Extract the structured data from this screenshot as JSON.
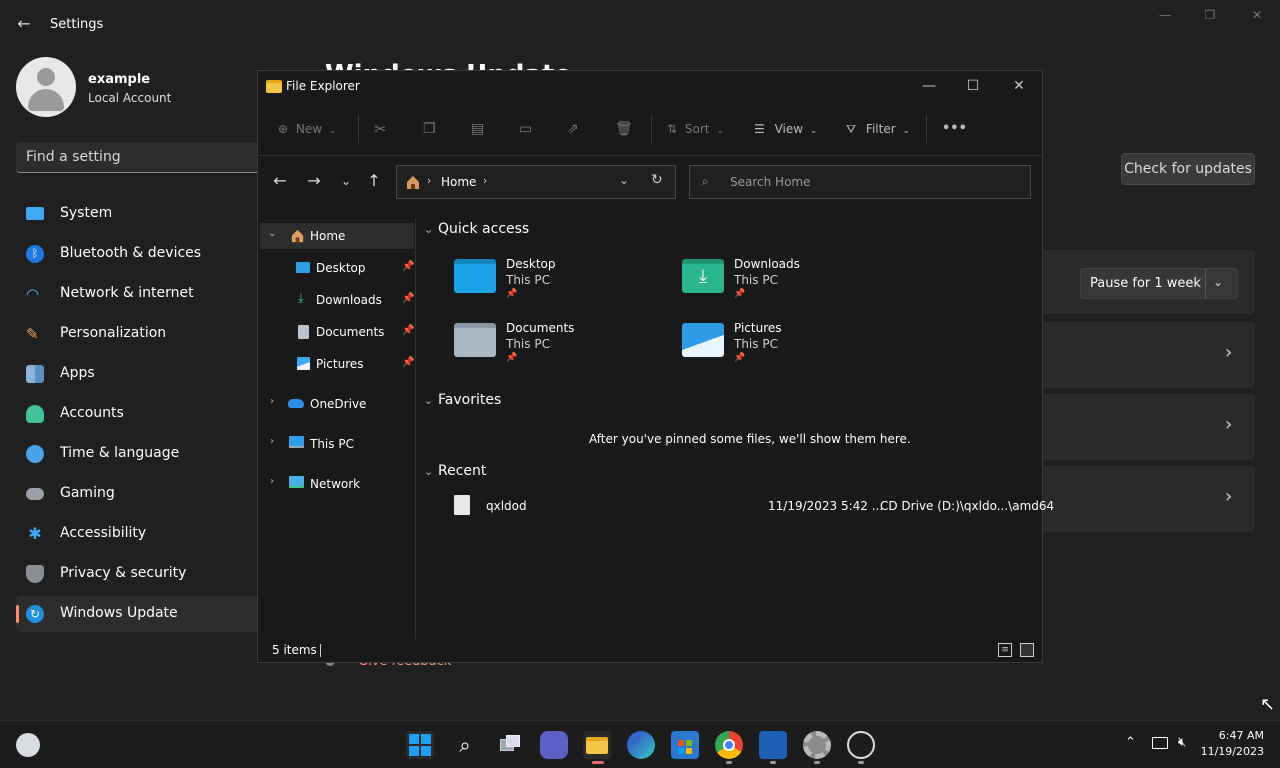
{
  "settings": {
    "title": "Settings",
    "user": {
      "name": "example",
      "type": "Local Account"
    },
    "search_placeholder": "Find a setting",
    "nav": [
      {
        "label": "System",
        "icon": "system-icon"
      },
      {
        "label": "Bluetooth & devices",
        "icon": "bluetooth-icon"
      },
      {
        "label": "Network & internet",
        "icon": "wifi-icon"
      },
      {
        "label": "Personalization",
        "icon": "brush-icon"
      },
      {
        "label": "Apps",
        "icon": "apps-icon"
      },
      {
        "label": "Accounts",
        "icon": "person-icon"
      },
      {
        "label": "Time & language",
        "icon": "clock-globe-icon"
      },
      {
        "label": "Gaming",
        "icon": "gamepad-icon"
      },
      {
        "label": "Accessibility",
        "icon": "accessibility-icon"
      },
      {
        "label": "Privacy & security",
        "icon": "shield-icon"
      },
      {
        "label": "Windows Update",
        "icon": "update-icon",
        "selected": true
      }
    ],
    "page_title": "Windows Update",
    "check_button": "Check for updates",
    "pause_button": "Pause for 1 week",
    "feedback": "Give feedback"
  },
  "explorer": {
    "title": "File Explorer",
    "toolbar": {
      "new": "New",
      "sort": "Sort",
      "view": "View",
      "filter": "Filter",
      "more": "•••"
    },
    "address": {
      "crumb": "Home"
    },
    "search_placeholder": "Search Home",
    "sidebar": [
      {
        "label": "Home",
        "icon": "home-icon",
        "expanded": true,
        "selected": true
      },
      {
        "label": "Desktop",
        "icon": "desktop-folder-icon",
        "pinned": true
      },
      {
        "label": "Downloads",
        "icon": "download-icon",
        "pinned": true
      },
      {
        "label": "Documents",
        "icon": "documents-icon",
        "pinned": true
      },
      {
        "label": "Pictures",
        "icon": "pictures-icon",
        "pinned": true
      },
      {
        "label": "OneDrive",
        "icon": "cloud-icon"
      },
      {
        "label": "This PC",
        "icon": "monitor-icon"
      },
      {
        "label": "Network",
        "icon": "network-icon"
      }
    ],
    "sections": {
      "quick_access": "Quick access",
      "favorites": "Favorites",
      "recent": "Recent"
    },
    "quick_access": [
      {
        "name": "Desktop",
        "location": "This PC"
      },
      {
        "name": "Downloads",
        "location": "This PC"
      },
      {
        "name": "Documents",
        "location": "This PC"
      },
      {
        "name": "Pictures",
        "location": "This PC"
      }
    ],
    "favorites_empty": "After you've pinned some files, we'll show them here.",
    "recent": [
      {
        "name": "qxldod",
        "date": "11/19/2023 5:42 ...",
        "path": "CD Drive (D:)\\qxldo...\\amd64"
      }
    ],
    "status": "5 items"
  },
  "taskbar": {
    "time": "6:47 AM",
    "date": "11/19/2023"
  },
  "colors": {
    "accent": "#0078d4",
    "settings_bg": "#202020",
    "explorer_bg": "#191919"
  }
}
